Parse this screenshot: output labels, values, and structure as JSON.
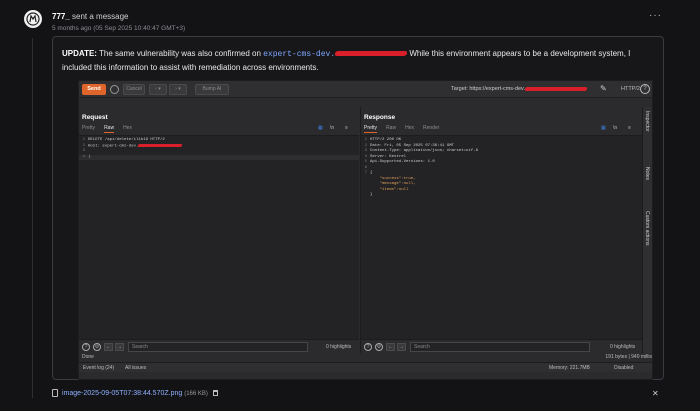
{
  "message": {
    "sender": "777_",
    "action": " sent a message",
    "timestamp": "5 months ago (05 Sep 2025 10:40:47 GMT+3)",
    "update_label": "UPDATE:",
    "text_before": " The same vulnerability was also confirmed on ",
    "code_host": "expert-cms-dev.",
    "text_after": " While this environment appears to be a development system, I included this information to assist with remediation across environments."
  },
  "burp": {
    "send": "Send",
    "cancel": "Cancel",
    "bump": "Bump AI",
    "target_label": "Target: https://expert-cms-dev.",
    "protocol": "HTTP/2",
    "request": {
      "title": "Request",
      "tabs": [
        "Pretty",
        "Raw",
        "Hex"
      ],
      "active_tab": "Raw",
      "lines": [
        {
          "n": "1",
          "t": "DELETE /api/delete/il1b19 HTTP/2"
        },
        {
          "n": "2",
          "t": "Host: expert-cms-dev."
        },
        {
          "n": "3",
          "t": ""
        },
        {
          "n": "4",
          "t": ""
        }
      ],
      "search_placeholder": "Search",
      "highlights": "0 highlights"
    },
    "response": {
      "title": "Response",
      "tabs": [
        "Pretty",
        "Raw",
        "Hex",
        "Render"
      ],
      "active_tab": "Pretty",
      "lines": [
        {
          "n": "1",
          "t": "HTTP/2 200 OK"
        },
        {
          "n": "2",
          "t": "Date: Fri, 05 Sep 2025 07:36:41 GMT"
        },
        {
          "n": "3",
          "t": "Content-Type: application/json; charset=utf-8"
        },
        {
          "n": "4",
          "t": "Server: Kestrel"
        },
        {
          "n": "5",
          "t": "Api-Supported-Versions: 1.0"
        },
        {
          "n": "6",
          "t": ""
        },
        {
          "n": "7",
          "t": "{"
        },
        {
          "n": "",
          "t": "    \"success\":true,"
        },
        {
          "n": "",
          "t": "    \"message\":null,"
        },
        {
          "n": "",
          "t": "    \"items\":null"
        },
        {
          "n": "",
          "t": "}"
        }
      ],
      "search_placeholder": "Search",
      "highlights": "0 highlights"
    },
    "side_tabs": [
      "Inspector",
      "Notes",
      "Custom actions"
    ],
    "status_left": "Done",
    "status_right": "191 bytes | 940 millis",
    "event_log": "Event log (24)",
    "all_issues": "All issues",
    "memory": "Memory: 221.7MB",
    "disabled": "Disabled"
  },
  "attachment": {
    "filename": "image-2025-09-05T07:38:44.570Z.png",
    "size": "(166 KB)"
  },
  "colors": {
    "accent": "#e0652a",
    "link": "#7ea6ff",
    "redaction": "#d9202a"
  }
}
